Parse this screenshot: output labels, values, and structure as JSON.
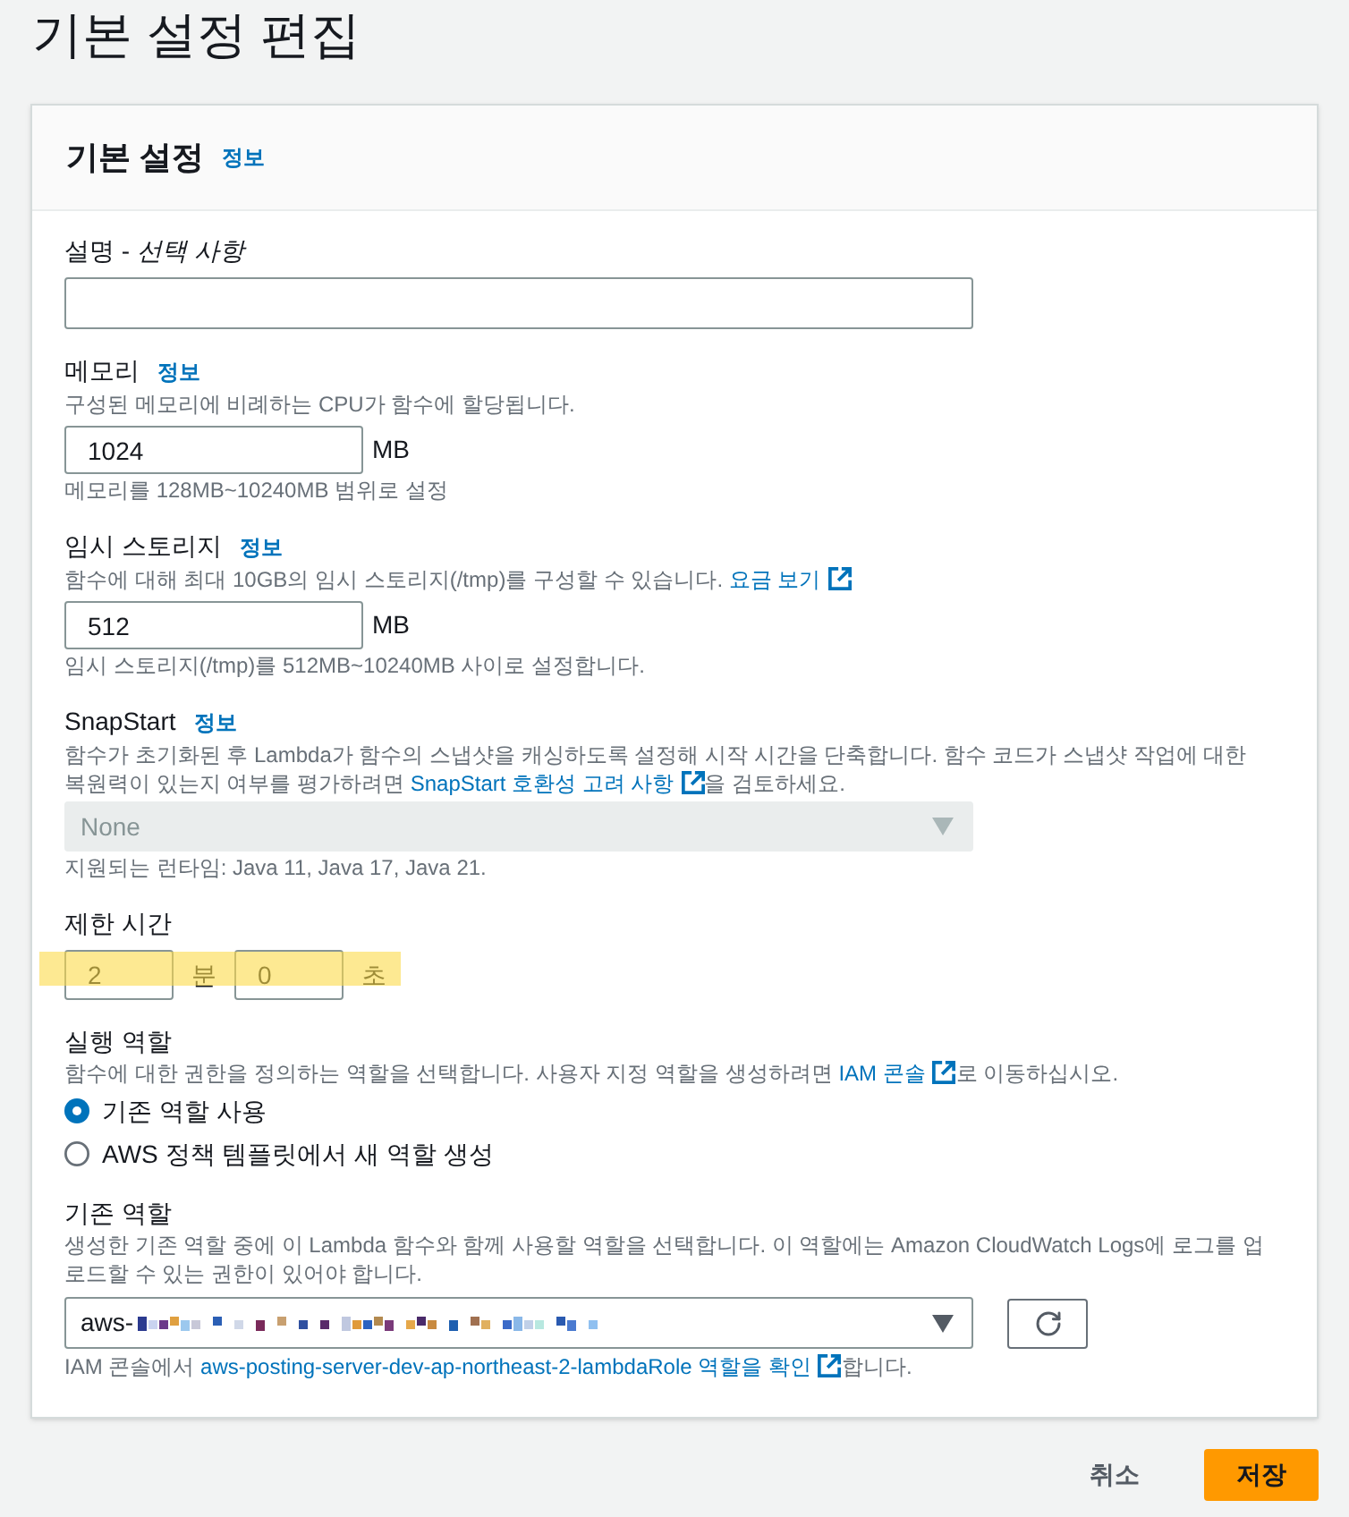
{
  "page_title": "기본 설정 편집",
  "panel": {
    "title": "기본 설정",
    "info": "정보"
  },
  "sections": [
    {
      "kind": "text",
      "label": "설명 - *선택 사항*"
    },
    {
      "kind": "number",
      "label": "메모리",
      "info": "정보",
      "description": "구성된 메모리에 비례하는 CPU가 함수에 할당됩니다.",
      "value": "1024",
      "unit": "MB",
      "hint": "메모리를 128MB~10240MB 범위로 설정"
    },
    {
      "kind": "number",
      "label": "임시 스토리지",
      "info": "정보",
      "description": "함수에 대해 최대 10GB의 임시 스토리지(/tmp)를 구성할 수 있습니다.",
      "link": "요금 보기",
      "value": "512",
      "unit": "MB",
      "hint": "임시 스토리지(/tmp)를 512MB~10240MB 사이로 설정합니다."
    },
    {
      "kind": "select",
      "label": "SnapStart",
      "info": "정보",
      "description": "함수가 초기화된 후 Lambda가 함수의 스냅샷을 캐싱하도록 설정해 시작 시간을 단축합니다. 함수 코드가 스냅샷 작업에 대한 복원력이 있는지 여부를 평가하려면",
      "link": "SnapStart 호환성 고려 사항",
      "description_after": "을 검토하세요.",
      "value": "None",
      "disabled": true,
      "hint": "지원되는 런타임: Java 11, Java 17, Java 21."
    },
    {
      "kind": "duration",
      "label": "제한 시간",
      "highlighted": true,
      "parts": [
        {
          "value": "2",
          "unit": "분"
        },
        {
          "value": "0",
          "unit": "초"
        }
      ]
    },
    {
      "kind": "radio",
      "label": "실행 역할",
      "description": "함수에 대한 권한을 정의하는 역할을 선택합니다. 사용자 지정 역할을 생성하려면",
      "link": "IAM 콘솔",
      "description_after": "로 이동하십시오.",
      "options": [
        {
          "label": "기존 역할 사용",
          "selected": true
        },
        {
          "label": "AWS 정책 템플릿에서 새 역할 생성",
          "selected": false
        }
      ]
    },
    {
      "kind": "role_select",
      "label": "기존 역할",
      "description": "생성한 기존 역할 중에 이 Lambda 함수와 함께 사용할 역할을 선택합니다. 이 역할에는 Amazon CloudWatch Logs에 로그를 업로드할 수 있는 권한이 있어야 합니다.",
      "value": "aws-",
      "hint_before": "IAM 콘솔에서",
      "hint_link": "aws-posting-server-dev-ap-northeast-2-lambdaRole 역할을 확인",
      "hint_after": "합니다."
    }
  ],
  "actions": [
    {
      "kind": "link",
      "label": "취소"
    },
    {
      "kind": "primary",
      "label": "저장"
    }
  ]
}
